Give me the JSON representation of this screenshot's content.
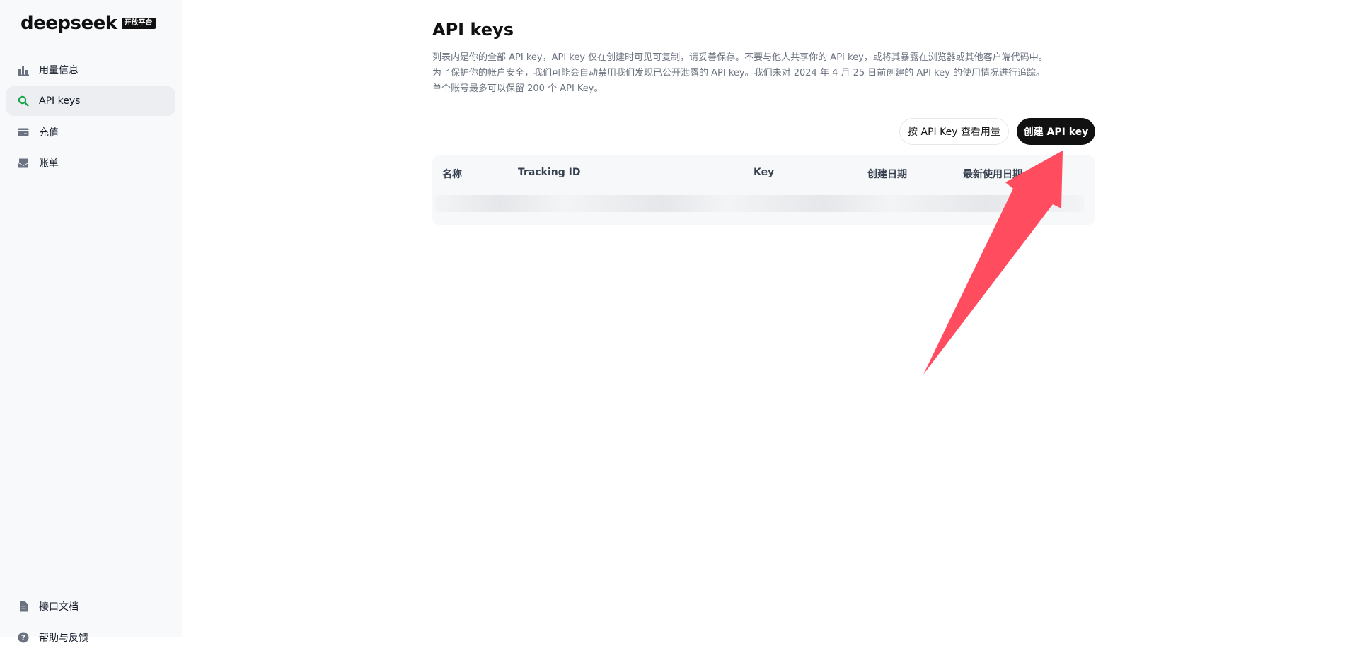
{
  "brand": {
    "name": "deepseek",
    "badge": "开放平台"
  },
  "sidebar": {
    "items": [
      {
        "label": "用量信息",
        "icon": "bar-chart-icon"
      },
      {
        "label": "API keys",
        "icon": "search-icon",
        "active": true
      },
      {
        "label": "充值",
        "icon": "card-icon"
      },
      {
        "label": "账单",
        "icon": "inbox-icon"
      }
    ],
    "bottom": [
      {
        "label": "接口文档",
        "icon": "document-icon"
      },
      {
        "label": "帮助与反馈",
        "icon": "help-icon"
      }
    ]
  },
  "main": {
    "title": "API keys",
    "description": [
      "列表内是你的全部 API key，API key 仅在创建时可见可复制，请妥善保存。不要与他人共享你的 API key，或将其暴露在浏览器或其他客户端代码中。",
      "为了保护你的帐户安全，我们可能会自动禁用我们发现已公开泄露的 API key。我们未对 2024 年 4 月 25 日前创建的 API key 的使用情况进行追踪。",
      "单个账号最多可以保留 200 个 API Key。"
    ],
    "buttons": {
      "usage": "按 API Key 查看用量",
      "create": "创建 API key"
    },
    "table": {
      "columns": [
        "名称",
        "Tracking ID",
        "Key",
        "创建日期",
        "最新使用日期"
      ]
    }
  },
  "colors": {
    "accent": "#111111",
    "active_icon": "#16a34a",
    "annotation_arrow": "#ff4d5f"
  }
}
